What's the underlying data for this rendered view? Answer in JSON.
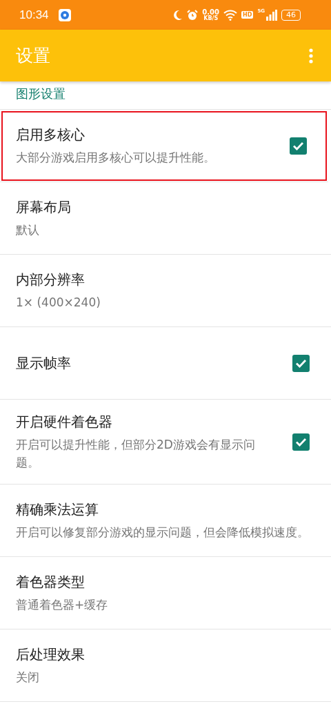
{
  "status_bar": {
    "time": "10:34",
    "net_speed": "0.00",
    "net_unit": "KB/S",
    "hd": "HD",
    "network": "5G",
    "battery": "46"
  },
  "app_bar": {
    "title": "设置"
  },
  "section": {
    "title": "图形设置"
  },
  "items": [
    {
      "kind": "checkbox",
      "title": "启用多核心",
      "summary": "大部分游戏启用多核心可以提升性能。",
      "checked": true,
      "highlighted": true
    },
    {
      "kind": "value",
      "title": "屏幕布局",
      "summary": "默认",
      "highlighted": false
    },
    {
      "kind": "value",
      "title": "内部分辨率",
      "summary": "1× (400×240)",
      "highlighted": false
    },
    {
      "kind": "checkbox",
      "title": "显示帧率",
      "checked": true,
      "highlighted": false
    },
    {
      "kind": "checkbox",
      "title": "开启硬件着色器",
      "summary": "开启可以提升性能，但部分2D游戏会有显示问题。",
      "checked": true,
      "highlighted": false
    },
    {
      "kind": "value",
      "title": "精确乘法运算",
      "summary": "开启可以修复部分游戏的显示问题，但会降低模拟速度。",
      "highlighted": false
    },
    {
      "kind": "value",
      "title": "着色器类型",
      "summary": "普通着色器+缓存",
      "highlighted": false
    },
    {
      "kind": "value",
      "title": "后处理效果",
      "summary": "关闭",
      "highlighted": false
    }
  ]
}
